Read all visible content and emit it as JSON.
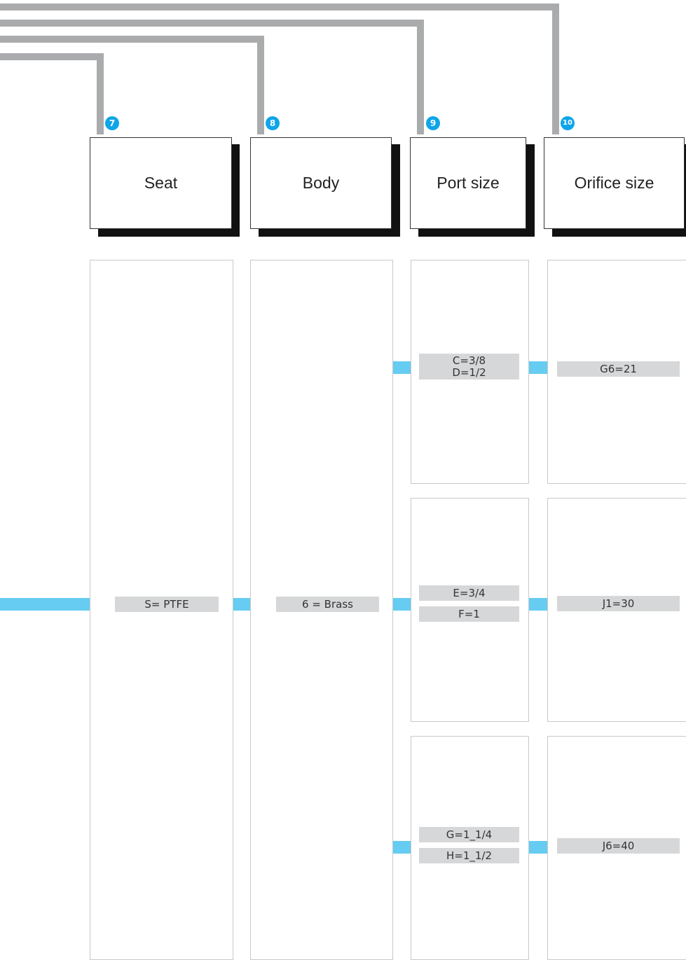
{
  "steps": [
    {
      "number": "7",
      "title": "Seat"
    },
    {
      "number": "8",
      "title": "Body"
    },
    {
      "number": "9",
      "title": "Port size"
    },
    {
      "number": "10",
      "title": "Orifice size"
    }
  ],
  "seat": {
    "option": "S= PTFE"
  },
  "body": {
    "option": "6 = Brass"
  },
  "port_size": {
    "group1": {
      "line1": "C=3/8",
      "line2": "D=1/2"
    },
    "group2": {
      "a": "E=3/4",
      "b": "F=1"
    },
    "group3": {
      "a": "G=1_1/4",
      "b": "H=1_1/2"
    }
  },
  "orifice_size": {
    "group1": "G6=21",
    "group2": "J1=30",
    "group3": "J6=40"
  },
  "colors": {
    "connector": "#a9abad",
    "link": "#66ccf1",
    "badge": "#0ea5e9",
    "chip": "#d6d7d8"
  }
}
